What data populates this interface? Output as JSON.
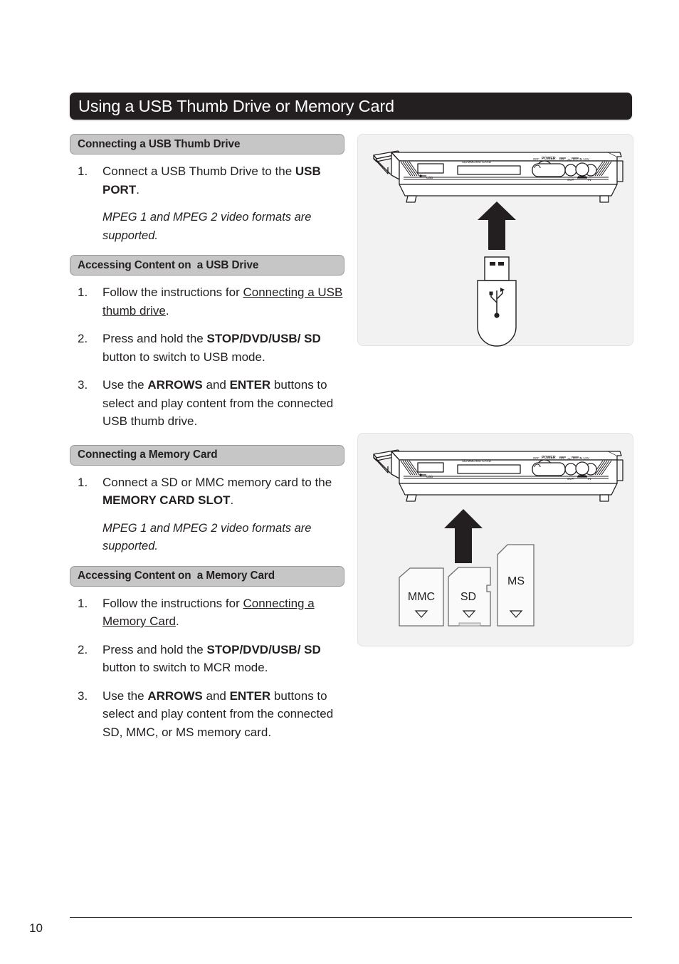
{
  "document": {
    "title": "Using a USB Thumb Drive or Memory Card",
    "page_number": "10"
  },
  "sections": [
    {
      "heading": "Connecting a USB Thumb Drive",
      "steps": [
        {
          "num": "1.",
          "html": "Connect a USB Thumb Drive to the <b>USB PORT</b>."
        }
      ],
      "note": "MPEG 1 and MPEG 2 video formats are supported."
    },
    {
      "heading": "Accessing Content on  a USB Drive",
      "steps": [
        {
          "num": "1.",
          "html": "Follow the instructions for <span class=\"u\">Connecting a USB thumb drive</span>."
        },
        {
          "num": "2.",
          "html": "Press and hold the <b>STOP/DVD/USB/ SD</b> button to switch to USB mode."
        },
        {
          "num": "3.",
          "html": "Use the <b>ARROWS</b> and <b>ENTER</b> buttons to select and play content from the connected USB thumb drive."
        }
      ],
      "note": ""
    },
    {
      "heading": "Connecting a Memory Card",
      "steps": [
        {
          "num": "1.",
          "html": "Connect a SD or MMC memory card to the <b>MEMORY CARD SLOT</b>."
        }
      ],
      "note": "MPEG 1 and MPEG 2 video formats are supported."
    },
    {
      "heading": "Accessing Content on  a Memory Card",
      "steps": [
        {
          "num": "1.",
          "html": "Follow the instructions for <span class=\"u\">Connecting a Memory Card</span>."
        },
        {
          "num": "2.",
          "html": "Press and hold the <b>STOP/DVD/USB/ SD</b> button to switch to MCR mode."
        },
        {
          "num": "3.",
          "html": "Use the <b>ARROWS</b> and <b>ENTER</b> buttons to select and play content from the connected SD, MMC, or MS memory card."
        }
      ],
      "note": ""
    }
  ],
  "illustrations": {
    "device_port_labels": {
      "usb": "USB",
      "card_slot": "SD/MMC/MS CARD",
      "av": "AV",
      "av_out": "OUT",
      "av_in": "IN",
      "power_off": "OFF",
      "power": "POWER",
      "power_on": "ON",
      "dc_in": "DC IN 12V"
    },
    "usb_panel": {
      "name": "usb-thumb-drive-insertion-diagram"
    },
    "card_panel": {
      "name": "memory-card-insertion-diagram",
      "cards": [
        {
          "label": "MMC"
        },
        {
          "label": "SD"
        },
        {
          "label": "MS"
        }
      ]
    }
  },
  "colors": {
    "title_bar_bg": "#231f20",
    "section_pill_bg": "#c6c6c6",
    "section_pill_border": "#9a9a9a",
    "panel_bg": "#f2f2f2",
    "ink": "#231f20"
  }
}
